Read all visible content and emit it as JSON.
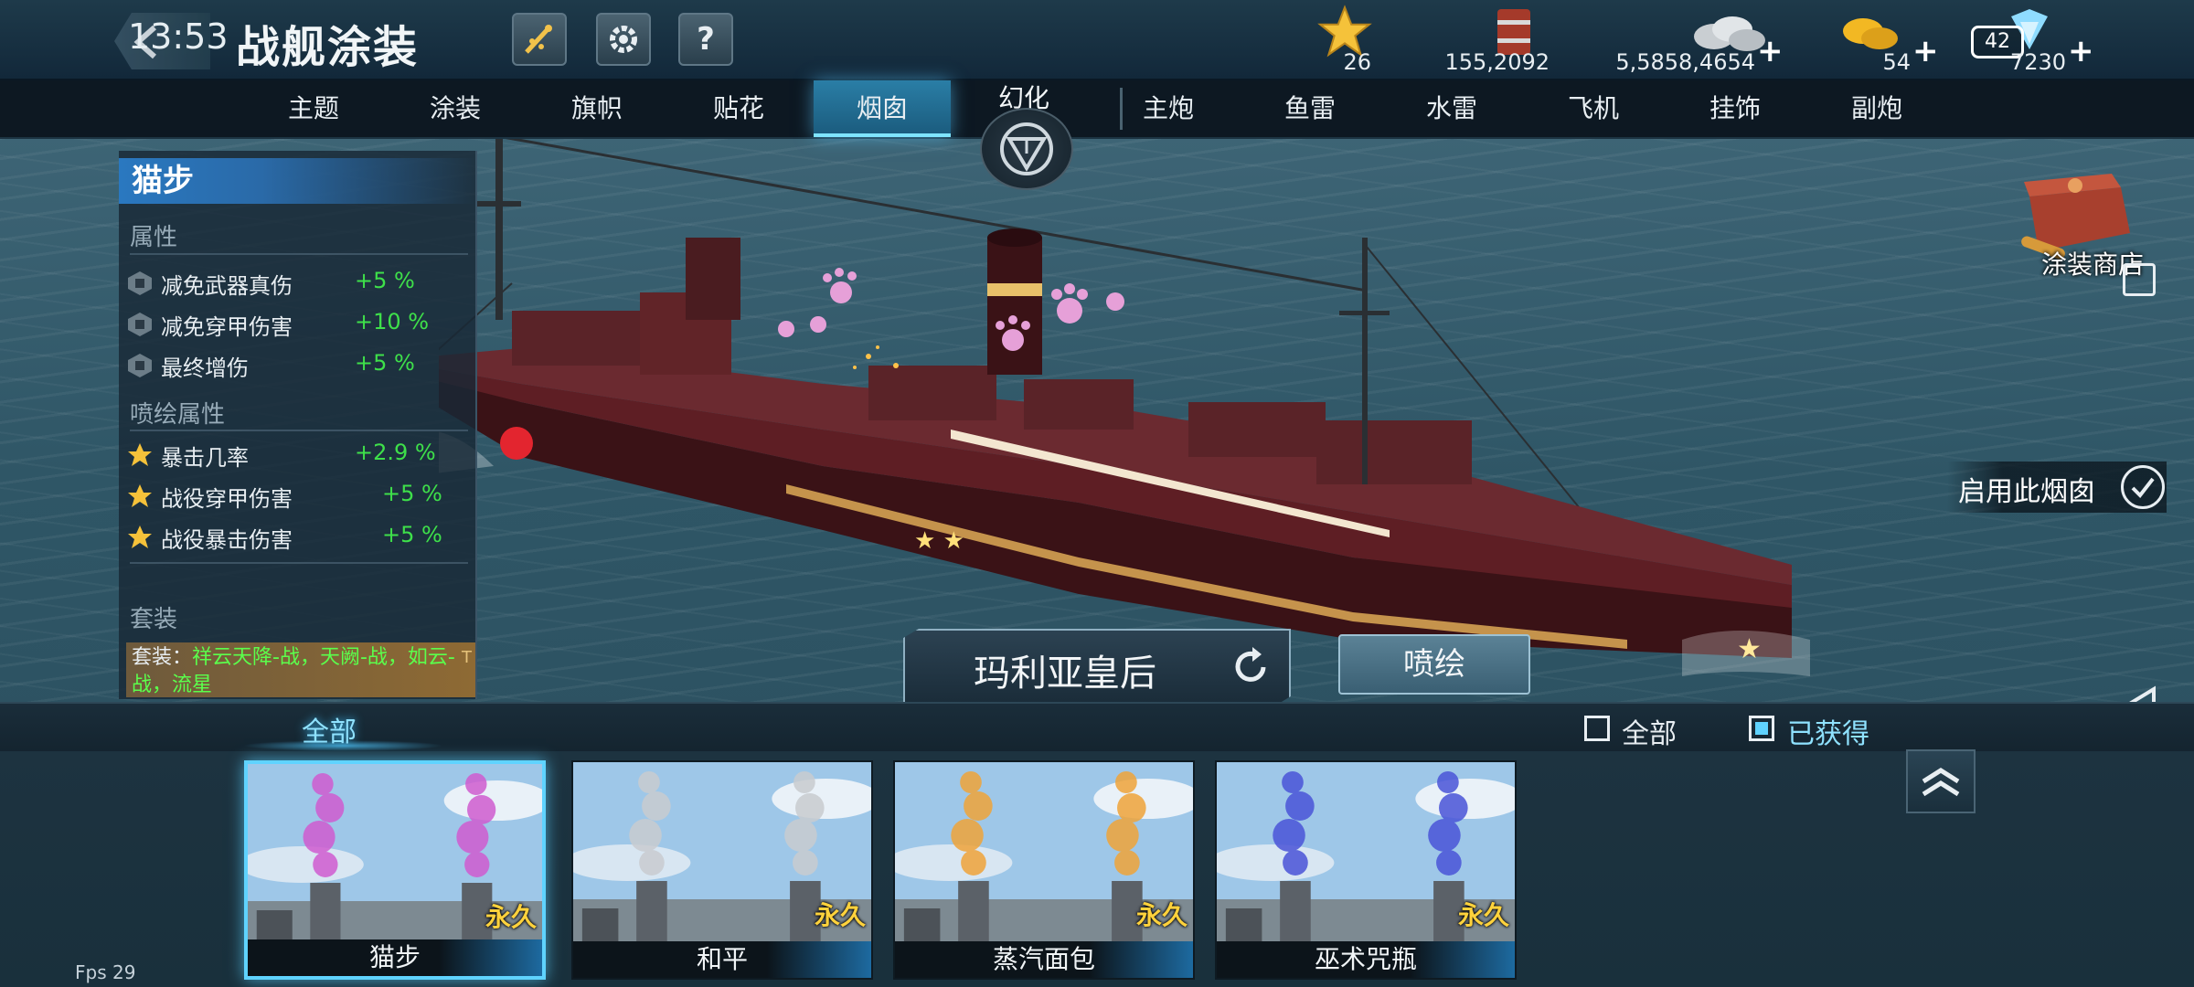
{
  "status": {
    "clock": "13:53"
  },
  "header": {
    "title": "战舰涂装"
  },
  "currencies": [
    {
      "name": "star",
      "value": "26",
      "plus": ""
    },
    {
      "name": "oil",
      "value": "155,2092",
      "plus": ""
    },
    {
      "name": "silver",
      "value": "5,5858,4654",
      "plus": "+"
    },
    {
      "name": "gold",
      "value": "54",
      "plus": "+"
    },
    {
      "name": "diamond",
      "value": "7230",
      "plus": "+",
      "badge": "42"
    }
  ],
  "tabs": [
    "主题",
    "涂装",
    "旗帜",
    "贴花",
    "烟囱",
    "主炮",
    "鱼雷",
    "水雷",
    "飞机",
    "挂饰",
    "副炮"
  ],
  "active_tab": "烟囱",
  "transform": {
    "label": "幻化"
  },
  "panel": {
    "skin_name": "猫步",
    "attr_header": "属性",
    "attributes": [
      {
        "label": "减免武器真伤",
        "value": "+5 %"
      },
      {
        "label": "减免穿甲伤害",
        "value": "+10 %"
      },
      {
        "label": "最终增伤",
        "value": "+5 %"
      }
    ],
    "spray_header": "喷绘属性",
    "spray_attributes": [
      {
        "label": "暴击几率",
        "value": "+2.9 %"
      },
      {
        "label": "战役穿甲伤害",
        "value": "+5 %"
      },
      {
        "label": "战役暴击伤害",
        "value": "+5 %"
      }
    ],
    "set_header": "套装",
    "set_prefix": "套装：",
    "set_items": "祥云天降-战，天阙-战，如云-战，流星",
    "set_tag": "T"
  },
  "side": {
    "shop_label": "涂装商店",
    "apply_label": "启用此烟囱"
  },
  "ship_name": "玛利亚皇后",
  "spray_button": "喷绘",
  "filter": {
    "category_tab": "全部",
    "checkbox_all": "全部",
    "checkbox_owned": "已获得",
    "owned_checked": true
  },
  "cards": [
    {
      "name": "猫步",
      "tag": "永久",
      "smoke": "#d05cd0",
      "selected": true
    },
    {
      "name": "和平",
      "tag": "永久",
      "smoke": "#c9ccd0",
      "selected": false
    },
    {
      "name": "蒸汽面包",
      "tag": "永久",
      "smoke": "#f0a43a",
      "selected": false
    },
    {
      "name": "巫术咒瓶",
      "tag": "永久",
      "smoke": "#4a54d8",
      "selected": false
    }
  ],
  "fps": "Fps 29"
}
